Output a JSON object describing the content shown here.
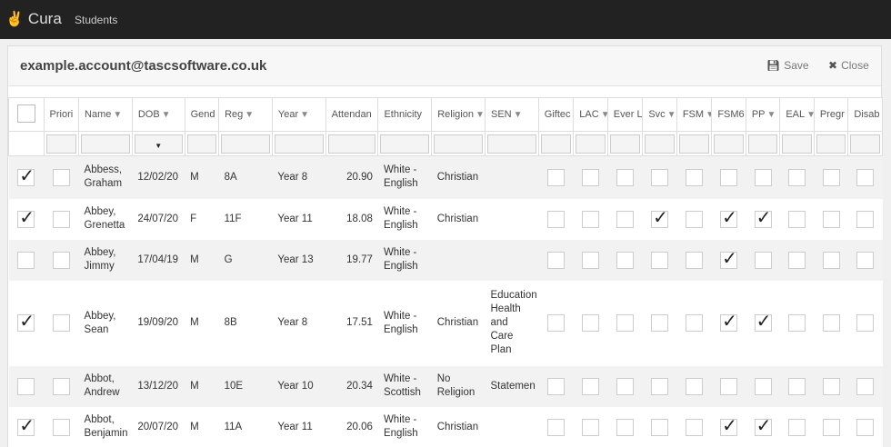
{
  "nav": {
    "brand": "Cura",
    "students": "Students"
  },
  "header": {
    "title": "example.account@tascsoftware.co.uk",
    "save": "Save",
    "close": "Close"
  },
  "columns": [
    {
      "label": ""
    },
    {
      "label": "Priori",
      "filter": false
    },
    {
      "label": "Name",
      "filter": true
    },
    {
      "label": "DOB",
      "filter": true
    },
    {
      "label": "Gend",
      "filter": false
    },
    {
      "label": "Reg",
      "filter": true
    },
    {
      "label": "Year",
      "filter": true
    },
    {
      "label": "Attendan",
      "filter": false
    },
    {
      "label": "Ethnicity",
      "filter": false
    },
    {
      "label": "Religion",
      "filter": true
    },
    {
      "label": "SEN",
      "filter": true
    },
    {
      "label": "Giftec",
      "filter": false
    },
    {
      "label": "LAC",
      "filter": true
    },
    {
      "label": "Ever L",
      "filter": false
    },
    {
      "label": "Svc",
      "filter": true
    },
    {
      "label": "FSM",
      "filter": true
    },
    {
      "label": "FSM6",
      "filter": false
    },
    {
      "label": "PP",
      "filter": true
    },
    {
      "label": "EAL",
      "filter": true
    },
    {
      "label": "Pregr",
      "filter": false
    },
    {
      "label": "Disab",
      "filter": false
    }
  ],
  "rows": [
    {
      "selected": true,
      "name": "Abbess, Graham",
      "dob": "12/02/20",
      "gender": "M",
      "reg": "8A",
      "year": "Year 8",
      "attendance": "20.90",
      "ethnicity": "White - English",
      "religion": "Christian",
      "sen": "",
      "svc": false,
      "fsm6": false,
      "pp": false
    },
    {
      "selected": true,
      "name": "Abbey, Grenetta",
      "dob": "24/07/20",
      "gender": "F",
      "reg": "11F",
      "year": "Year 11",
      "attendance": "18.08",
      "ethnicity": "White - English",
      "religion": "Christian",
      "sen": "",
      "svc": true,
      "fsm6": true,
      "pp": true
    },
    {
      "selected": false,
      "name": "Abbey, Jimmy",
      "dob": "17/04/19",
      "gender": "M",
      "reg": "G",
      "year": "Year 13",
      "attendance": "19.77",
      "ethnicity": "White - English",
      "religion": "",
      "sen": "",
      "svc": false,
      "fsm6": true,
      "pp": false
    },
    {
      "selected": true,
      "name": "Abbey, Sean",
      "dob": "19/09/20",
      "gender": "M",
      "reg": "8B",
      "year": "Year 8",
      "attendance": "17.51",
      "ethnicity": "White - English",
      "religion": "Christian",
      "sen": "Education Health and Care Plan",
      "svc": false,
      "fsm6": true,
      "pp": true
    },
    {
      "selected": false,
      "name": "Abbot, Andrew",
      "dob": "13/12/20",
      "gender": "M",
      "reg": "10E",
      "year": "Year 10",
      "attendance": "20.34",
      "ethnicity": "White - Scottish",
      "religion": "No Religion",
      "sen": "Statemen",
      "svc": false,
      "fsm6": false,
      "pp": false
    },
    {
      "selected": true,
      "name": "Abbot, Benjamin",
      "dob": "20/07/20",
      "gender": "M",
      "reg": "11A",
      "year": "Year 11",
      "attendance": "20.06",
      "ethnicity": "White - English",
      "religion": "Christian",
      "sen": "",
      "svc": false,
      "fsm6": true,
      "pp": true
    }
  ]
}
